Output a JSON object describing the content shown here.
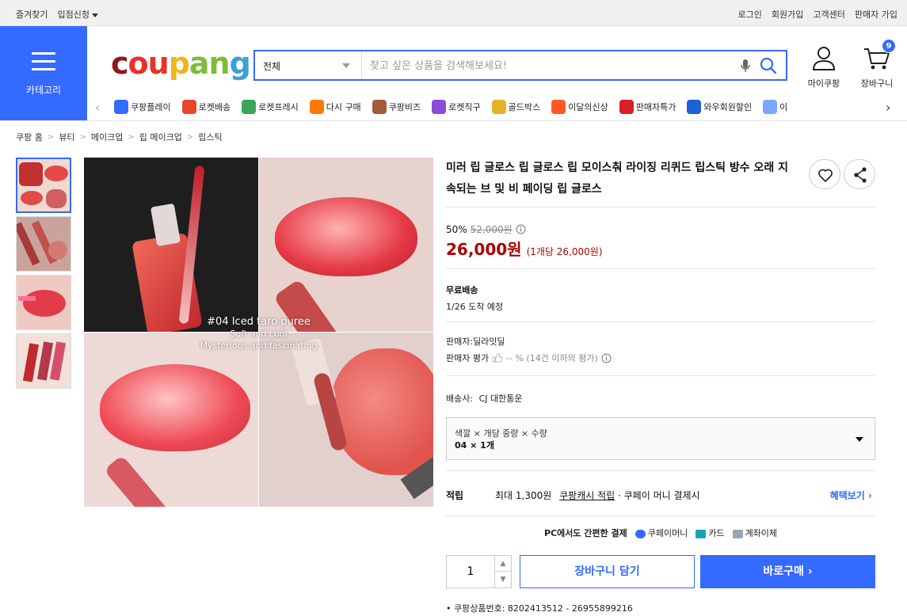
{
  "topbar": {
    "bookmark": "즐겨찾기",
    "seller_apply": "입점신청",
    "login": "로그인",
    "signup": "회원가입",
    "customer_center": "고객센터",
    "seller_signup": "판매자 가입"
  },
  "category": {
    "label": "카테고리"
  },
  "logo": {
    "p1": "c",
    "p2": "ou",
    "p3": "p",
    "p4": "an",
    "p5": "g"
  },
  "search": {
    "scope": "전체",
    "placeholder": "찾고 싶은 상품을 검색해보세요!"
  },
  "header": {
    "mycoupang": "마이쿠팡",
    "cart": "장바구니",
    "cart_count": "9"
  },
  "shortcuts": [
    {
      "label": "쿠팡플레이",
      "color": "#346aff"
    },
    {
      "label": "로켓배송",
      "color": "#e8452c"
    },
    {
      "label": "로켓프레시",
      "color": "#3aa656"
    },
    {
      "label": "다시 구매",
      "color": "#ff7a00"
    },
    {
      "label": "쿠팡비즈",
      "color": "#a35a3b"
    },
    {
      "label": "로켓직구",
      "color": "#8c4bd8"
    },
    {
      "label": "골드박스",
      "color": "#e8b12c"
    },
    {
      "label": "이달의신상",
      "color": "#ff5a1f"
    },
    {
      "label": "판매자특가",
      "color": "#d81f26"
    },
    {
      "label": "와우회원할인",
      "color": "#1d60d8"
    },
    {
      "label": "이",
      "color": "#7aa6ff"
    }
  ],
  "breadcrumb": [
    "쿠팡 홈",
    "뷰티",
    "메이크업",
    "립 메이크업",
    "립스틱"
  ],
  "image": {
    "caption_title": "#04 Iced taro puree",
    "caption_l2": "Soft and cool",
    "caption_l3": "Mysterious and fascinating"
  },
  "product": {
    "title": "미러 립 글로스 립 글로스 립 모이스춰 라이징 리퀴드 립스틱 방수 오래 지속되는 브 및 비 페이딩 립 글로스",
    "discount_rate": "50%",
    "original_price": "52,000원",
    "price": "26,000원",
    "unit_price": "(1개당 26,000원)",
    "shipping_label": "무료배송",
    "arrival": "1/26 도착 예정",
    "seller": "판매자:딜라잇딜",
    "seller_rating_label": "판매자 평가",
    "seller_rating_value": "-- % (14건 이하의 평가)",
    "carrier_label": "배송사:",
    "carrier": "CJ 대한통운",
    "option_label": "색깔 × 개당 중량 × 수량",
    "option_value": "04 × 1개",
    "reward_title": "적립",
    "reward_max": "최대 1,300원",
    "reward_link": "쿠팡캐시 적립",
    "reward_cond": "· 쿠페이 머니 결제시",
    "reward_more": "혜택보기",
    "pay_title": "PC에서도 간편한 결제",
    "pay_methods": [
      {
        "label": "쿠페이머니",
        "color": "#346aff"
      },
      {
        "label": "카드",
        "color": "#17a2b8"
      },
      {
        "label": "계좌이체",
        "color": "#9aa4b4"
      }
    ],
    "quantity": "1",
    "cart_button": "장바구니 담기",
    "buy_button": "바로구매",
    "product_id": "쿠팡상품번호: 8202413512 - 26955899216"
  },
  "colors": {
    "brand": "#346aff",
    "price": "#ae0000"
  }
}
